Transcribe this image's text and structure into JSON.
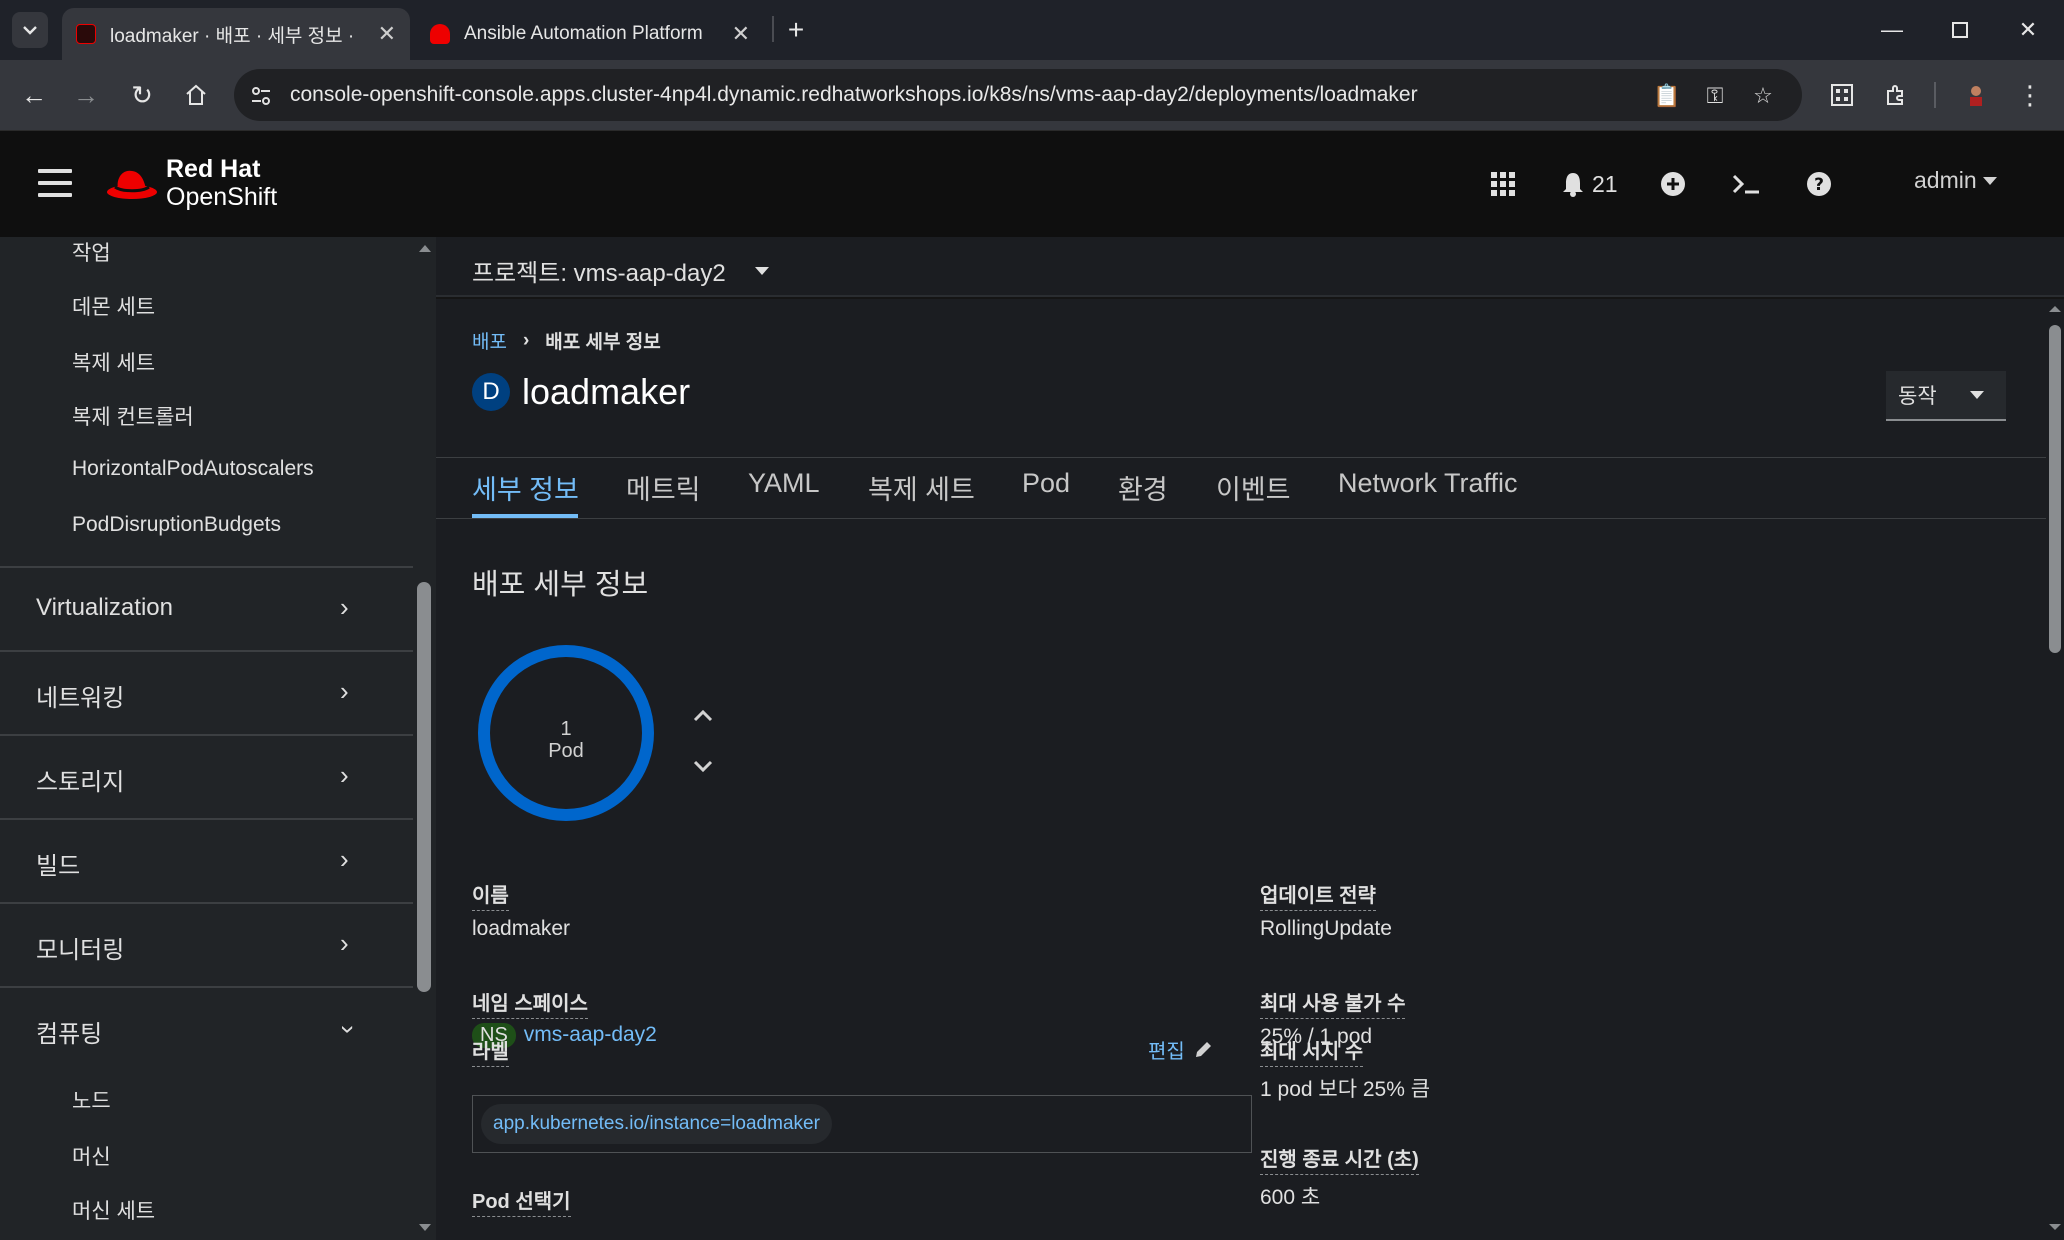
{
  "browser": {
    "tabs": [
      {
        "title": "loadmaker · 배포 · 세부 정보 ·",
        "active": true
      },
      {
        "title": "Ansible Automation Platform",
        "active": false
      }
    ],
    "new_tab": "+",
    "url": "console-openshift-console.apps.cluster-4np4l.dynamic.redhatworkshops.io/k8s/ns/vms-aap-day2/deployments/loadmaker"
  },
  "masthead": {
    "brand_line1": "Red Hat",
    "brand_line2": "OpenShift",
    "notifications_count": "21",
    "user": "admin"
  },
  "sidebar": {
    "sub_items_top": [
      "작업",
      "데몬 세트",
      "복제 세트",
      "복제 컨트롤러",
      "HorizontalPodAutoscalers",
      "PodDisruptionBudgets"
    ],
    "groups": [
      "Virtualization",
      "네트워킹",
      "스토리지",
      "빌드",
      "모니터링",
      "컴퓨팅"
    ],
    "sub_items_compute": [
      "노드",
      "머신",
      "머신 세트"
    ]
  },
  "project": {
    "label": "프로젝트: vms-aap-day2"
  },
  "breadcrumb": {
    "parent": "배포",
    "current": "배포 세부 정보"
  },
  "resource": {
    "kind_badge": "D",
    "name": "loadmaker",
    "actions_label": "동작"
  },
  "tabs": [
    "세부 정보",
    "메트릭",
    "YAML",
    "복제 세트",
    "Pod",
    "환경",
    "이벤트",
    "Network Traffic"
  ],
  "details": {
    "section_title": "배포 세부 정보",
    "pod_count": "1",
    "pod_unit": "Pod",
    "left": {
      "name_label": "이름",
      "name_value": "loadmaker",
      "namespace_label": "네임 스페이스",
      "namespace_badge": "NS",
      "namespace_value": "vms-aap-day2",
      "labels_label": "라벨",
      "edit_label": "편집",
      "label_chip": "app.kubernetes.io/instance=loadmaker",
      "pod_selector_label": "Pod 선택기"
    },
    "right": {
      "strategy_label": "업데이트 전략",
      "strategy_value": "RollingUpdate",
      "max_unavailable_label": "최대 사용 불가 수",
      "max_unavailable_value": "25% / 1 pod",
      "max_surge_label": "최대 서지 수",
      "max_surge_value": "1 pod 보다 25% 큼",
      "progress_deadline_label": "진행 종료 시간 (초)",
      "progress_deadline_value": "600 초"
    }
  },
  "colors": {
    "accent": "#73bcf7",
    "donut": "#0066cc",
    "brand_red": "#ee0000"
  }
}
